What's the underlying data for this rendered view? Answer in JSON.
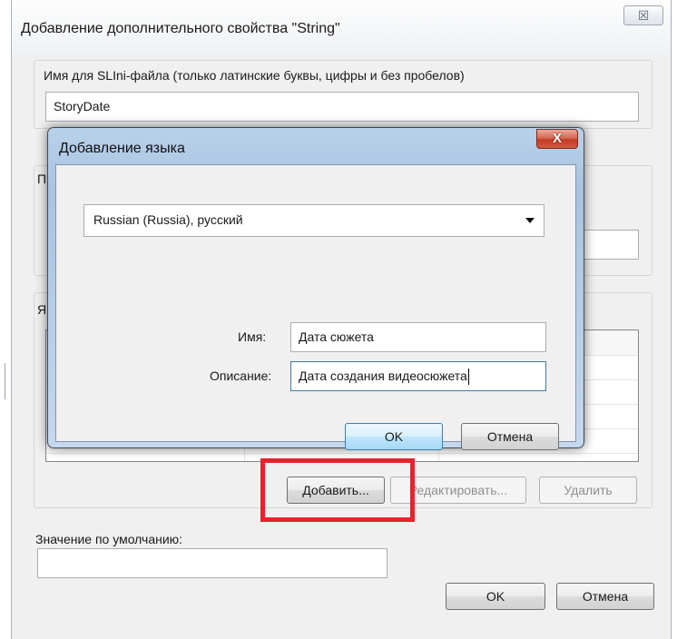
{
  "outer_dialog": {
    "title": "Добавление дополнительного свойства \"String\"",
    "close_symbol": "☒",
    "ini_name_label": "Имя для SLIni-файла (только латинские буквы, цифры и без пробелов)",
    "ini_name_value": "StoryDate",
    "partial_group_letter_1": "П",
    "partial_group_letter_2": "Я",
    "add_button": "Добавить...",
    "edit_button": "Редактировать...",
    "delete_button": "Удалить",
    "default_value_label": "Значение по умолчанию:",
    "default_value": "",
    "ok_button": "OK",
    "cancel_button": "Отмена"
  },
  "language_dialog": {
    "title": "Добавление языка",
    "close_symbol": "X",
    "language_selected": "Russian (Russia), русский",
    "name_label": "Имя:",
    "name_value": "Дата сюжета",
    "description_label": "Описание:",
    "description_value": "Дата создания видеосюжета",
    "ok_button": "OK",
    "cancel_button": "Отмена"
  },
  "colors": {
    "highlight": "#e8232d",
    "window_bg": "#f0f0f0",
    "modal_frame": "#b9d1ea",
    "close_red": "#c23c22"
  }
}
